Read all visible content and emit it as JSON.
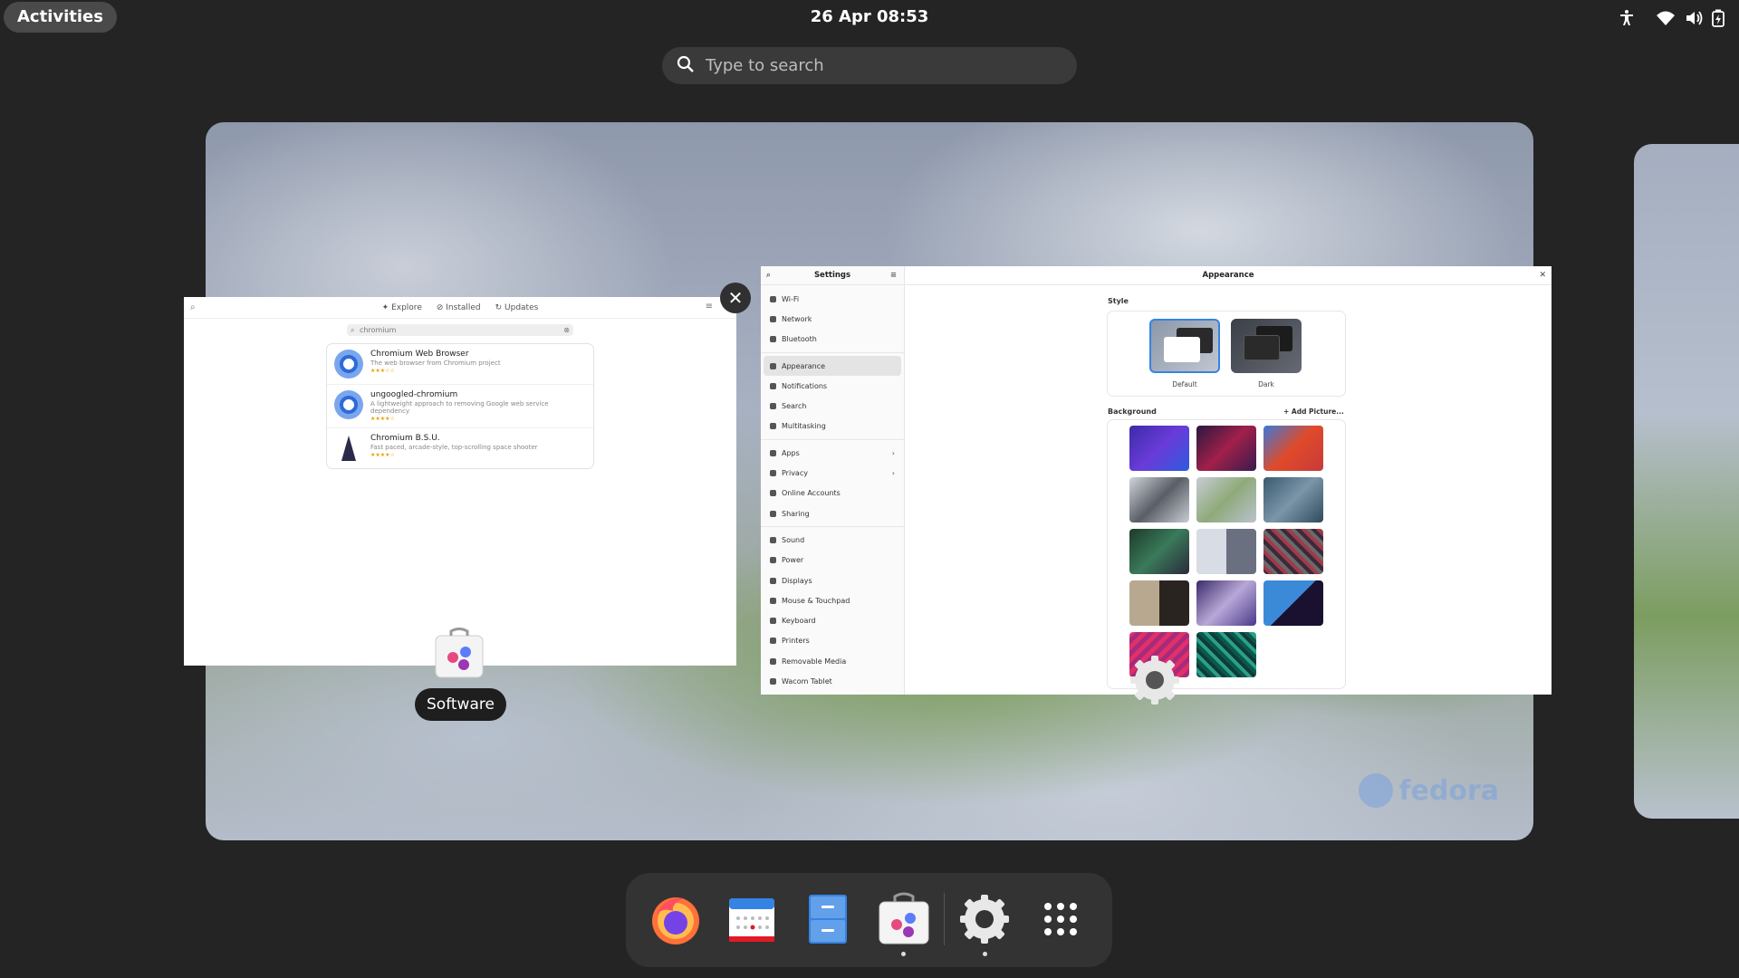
{
  "topbar": {
    "activities_label": "Activities",
    "clock": "26 Apr  08:53"
  },
  "search": {
    "placeholder": "Type to search"
  },
  "software_window": {
    "tabs": [
      "Explore",
      "Installed",
      "Updates"
    ],
    "search_value": "chromium",
    "results": [
      {
        "name": "Chromium Web Browser",
        "desc": "The web browser from Chromium project",
        "stars": "★★★☆☆"
      },
      {
        "name": "ungoogled-chromium",
        "desc": "A lightweight approach to removing Google web service dependency",
        "stars": "★★★★☆"
      },
      {
        "name": "Chromium B.S.U.",
        "desc": "Fast paced, arcade-style, top-scrolling space shooter",
        "stars": "★★★★☆"
      }
    ],
    "app_label": "Software"
  },
  "settings_window": {
    "sidebar_title": "Settings",
    "main_title": "Appearance",
    "sidebar_items": [
      {
        "label": "Wi-Fi"
      },
      {
        "label": "Network"
      },
      {
        "label": "Bluetooth"
      },
      {
        "label": "Appearance"
      },
      {
        "label": "Notifications"
      },
      {
        "label": "Search"
      },
      {
        "label": "Multitasking"
      },
      {
        "label": "Apps"
      },
      {
        "label": "Privacy"
      },
      {
        "label": "Online Accounts"
      },
      {
        "label": "Sharing"
      },
      {
        "label": "Sound"
      },
      {
        "label": "Power"
      },
      {
        "label": "Displays"
      },
      {
        "label": "Mouse & Touchpad"
      },
      {
        "label": "Keyboard"
      },
      {
        "label": "Printers"
      },
      {
        "label": "Removable Media"
      },
      {
        "label": "Wacom Tablet"
      }
    ],
    "style_section": "Style",
    "style_options": [
      "Default",
      "Dark"
    ],
    "background_section": "Background",
    "add_picture": "+ Add Picture..."
  },
  "workspace": {
    "logo_text": "fedora"
  },
  "dash": {
    "apps": [
      "firefox-icon",
      "calendar-icon",
      "files-icon",
      "software-icon",
      "settings-icon",
      "app-grid-icon"
    ]
  },
  "colors": {
    "accent": "#3584e4",
    "panel": "#242424",
    "dash": "#333333"
  }
}
